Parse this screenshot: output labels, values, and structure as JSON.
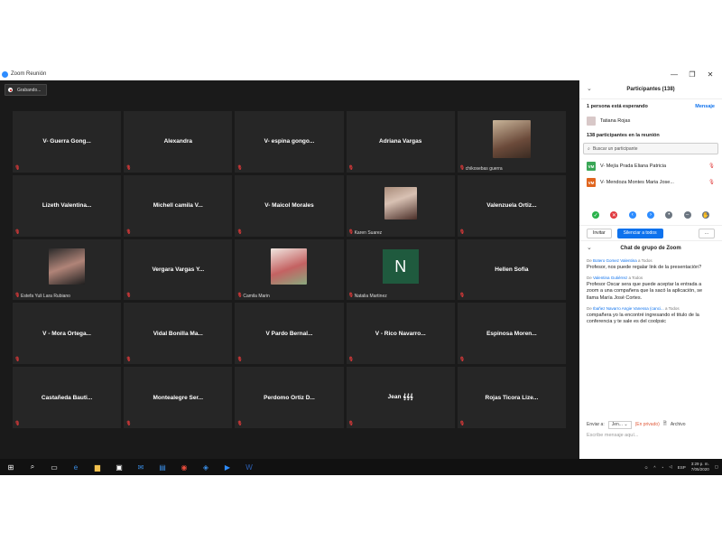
{
  "window": {
    "title": "Zoom Reunión",
    "controls": [
      "—",
      "❐",
      "✕"
    ]
  },
  "meeting": {
    "recording_label": "Grabando...",
    "tiles": [
      {
        "name": "V- Guerra Gong...",
        "sub": ""
      },
      {
        "name": "Alexandra",
        "sub": ""
      },
      {
        "name": "V- espina gongo...",
        "sub": ""
      },
      {
        "name": "Adriana Vargas",
        "sub": ""
      },
      {
        "name": "",
        "sub": "chikosebas guerra"
      },
      {
        "name": "Lizeth Valentina...",
        "sub": ""
      },
      {
        "name": "Michell camila V...",
        "sub": ""
      },
      {
        "name": "V- Maicol Morales",
        "sub": ""
      },
      {
        "name": "",
        "sub": "Karen Suarez"
      },
      {
        "name": "Valenzuela Ortiz...",
        "sub": ""
      },
      {
        "name": "",
        "sub": "Estefa Yuli Lara Rubiano"
      },
      {
        "name": "Vergara Vargas Y...",
        "sub": ""
      },
      {
        "name": "",
        "sub": "Camila Marin"
      },
      {
        "name": "",
        "sub": "Natalia Martinez",
        "letter": "N"
      },
      {
        "name": "Hellen Sofia",
        "sub": ""
      },
      {
        "name": "V - Mora Ortega...",
        "sub": ""
      },
      {
        "name": "Vidal Bonilla Ma...",
        "sub": ""
      },
      {
        "name": "V Pardo Bernal...",
        "sub": ""
      },
      {
        "name": "V - Rico Navarro...",
        "sub": ""
      },
      {
        "name": "Espinosa Moren...",
        "sub": ""
      },
      {
        "name": "Castañeda Bauti...",
        "sub": ""
      },
      {
        "name": "Montealegre Ser...",
        "sub": ""
      },
      {
        "name": "Perdomo Ortiz D...",
        "sub": ""
      },
      {
        "name": "Jean 𝄞𝄞𝄞",
        "sub": ""
      },
      {
        "name": "Rojas Ticora Lize...",
        "sub": ""
      }
    ]
  },
  "panel": {
    "participants_title": "Participantes (138)",
    "waiting_label": "1 persona está esperando",
    "message_link": "Mensaje",
    "waiting_person": "Tatiana Rojas",
    "in_meeting_label": "138 participantes en la reunión",
    "search_placeholder": "Buscar un participante",
    "participants": [
      {
        "initials": "VM",
        "name": "V- Mejía Prada Eliana Patricia",
        "color": "#3aa757"
      },
      {
        "initials": "VM",
        "name": "V- Mendoza Montes Maria Jose...",
        "color": "#e0651e"
      }
    ],
    "invite_label": "Invitar",
    "mute_all_label": "Silenciar a todos",
    "more_label": "...",
    "chat_title": "Chat de grupo de Zoom",
    "chat": [
      {
        "from": "Botero Gomez Valentina",
        "to": " a Todos",
        "text": "Profesor, nos puede regalar link de la presentación?"
      },
      {
        "from": "Valentina Gutiérrez",
        "to": " a Todos",
        "text": "Profesor Oscar sera que puede aceptar la entrada a zoom a una compañera que la sacó la aplicación, se llama María José Cortes."
      },
      {
        "from": "Ibañez Navarro Angie Vanessa (canci...",
        "to": " a Todos",
        "text": "compañera yo la encontré ingresando el titulo de la conferencia y te sale es del coolpsic"
      }
    ],
    "send_to_label": "Enviar a:",
    "send_to_value": "Jen...",
    "private_label": "(En privado)",
    "file_label": "Archivo",
    "message_placeholder": "Escribe mensaje aquí..."
  },
  "taskbar": {
    "language": "ESP",
    "time": "3:29 p. m.",
    "date": "7/05/2020"
  }
}
